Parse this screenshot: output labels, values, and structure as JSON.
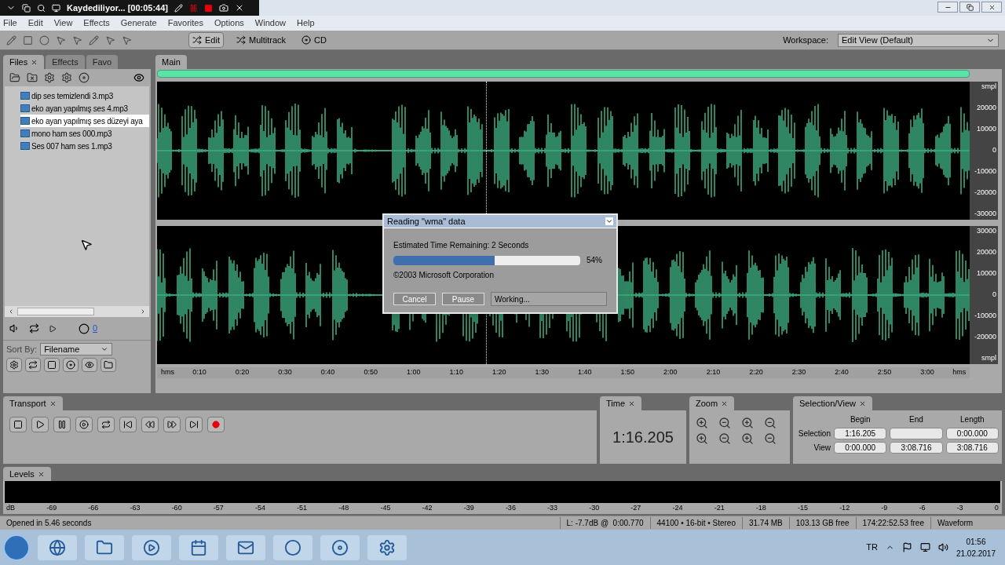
{
  "recorder_bar": {
    "title": "Kaydediliyor... [00:05:44]"
  },
  "menu": [
    "File",
    "Edit",
    "View",
    "Effects",
    "Generate",
    "Favorites",
    "Options",
    "Window",
    "Help"
  ],
  "toolbar": {
    "modes": [
      {
        "label": "Edit",
        "selected": true
      },
      {
        "label": "Multitrack",
        "selected": false
      },
      {
        "label": "CD",
        "selected": false
      }
    ],
    "workspace_label": "Workspace:",
    "workspace_value": "Edit View (Default)"
  },
  "files_panel": {
    "tabs": [
      {
        "label": "Files",
        "selected": true
      },
      {
        "label": "Effects",
        "selected": false
      },
      {
        "label": "Favo",
        "selected": false
      }
    ],
    "files": [
      {
        "name": "dip ses temizlendi 3.mp3",
        "selected": false
      },
      {
        "name": "eko ayan yapılmış ses 4.mp3",
        "selected": false
      },
      {
        "name": "eko ayan yapılmış ses düzeyi aya",
        "selected": true
      },
      {
        "name": "mono ham ses 000.mp3",
        "selected": false
      },
      {
        "name": "Ses 007 ham ses 1.mp3",
        "selected": false
      }
    ],
    "volume": "0",
    "sort_label": "Sort By:",
    "sort_value": "Filename"
  },
  "editor": {
    "tab": "Main",
    "channels": [
      {
        "labels": [
          "smpl",
          "20000",
          "10000",
          "0",
          "-10000",
          "-20000",
          "-30000"
        ]
      },
      {
        "labels": [
          "30000",
          "20000",
          "10000",
          "0",
          "-10000",
          "-20000",
          "smpl"
        ]
      }
    ],
    "time_labels": [
      "hms",
      "0:10",
      "0:20",
      "0:30",
      "0:40",
      "0:50",
      "1:00",
      "1:10",
      "1:20",
      "1:30",
      "1:40",
      "1:50",
      "2:00",
      "2:10",
      "2:20",
      "2:30",
      "2:40",
      "2:50",
      "3:00",
      "hms"
    ]
  },
  "dialog": {
    "title": "Reading \"wma\" data",
    "estimate": "Estimated Time Remaining: 2 Seconds",
    "level": 0.54,
    "percent": "54%",
    "copyright": "©2003 Microsoft Corporation",
    "buttons": [
      "Cancel",
      "Pause"
    ],
    "status": "Working..."
  },
  "transport": {
    "title": "Transport"
  },
  "time": {
    "title": "Time",
    "value": "1:16.205"
  },
  "zoom": {
    "title": "Zoom"
  },
  "selection_view": {
    "title": "Selection/View",
    "columns": [
      "Begin",
      "End",
      "Length"
    ],
    "rows": [
      {
        "label": "Selection",
        "begin": "1:16.205",
        "length": "0:00.000"
      },
      {
        "label": "View",
        "begin": "0:00.000",
        "end": "3:08.716",
        "length": "3:08.716"
      }
    ]
  },
  "levels": {
    "title": "Levels",
    "scale": [
      "dB",
      "-69",
      "-66",
      "-63",
      "-60",
      "-57",
      "-54",
      "-51",
      "-48",
      "-45",
      "-42",
      "-39",
      "-36",
      "-33",
      "-30",
      "-27",
      "-24",
      "-21",
      "-18",
      "-15",
      "-12",
      "-9",
      "-6",
      "-3",
      "0"
    ]
  },
  "status_bar": [
    "Opened in 5.46 seconds",
    "L: -7.7dB @  0:00.770",
    "44100 • 16-bit • Stereo",
    "31.74 MB",
    "103.13 GB free",
    "174:22:52.53 free",
    "Waveform"
  ],
  "taskbar": {
    "language": "TR",
    "time": "01:56",
    "date": "21.02.2017"
  }
}
